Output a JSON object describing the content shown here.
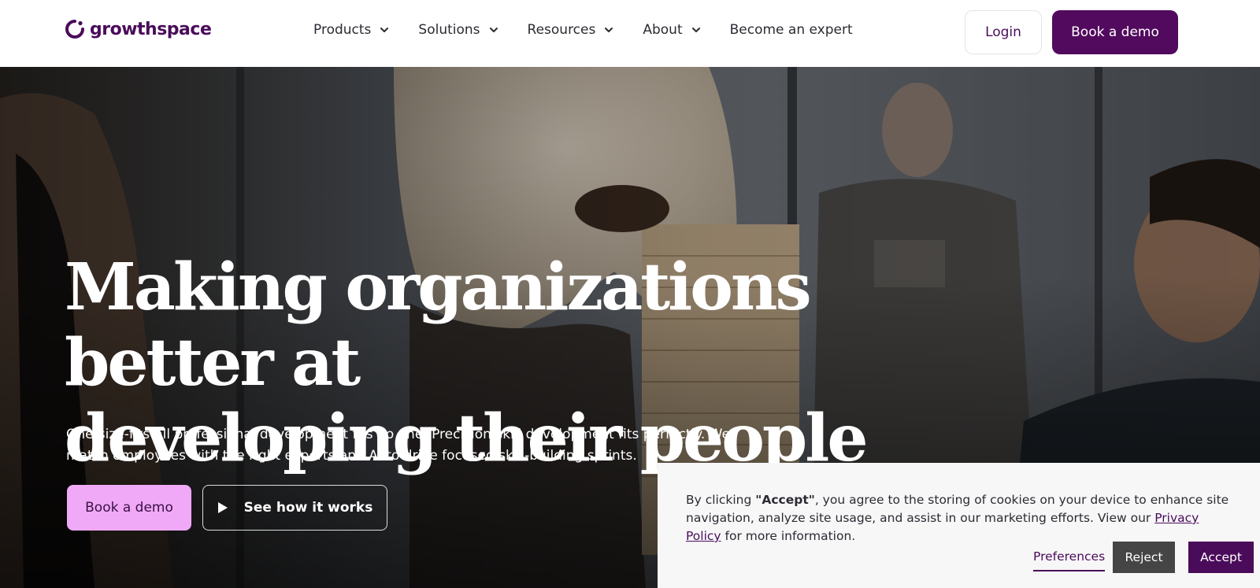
{
  "brand": {
    "name": "growthspace",
    "color": "#4a0c5a"
  },
  "nav": {
    "items": [
      {
        "label": "Products",
        "icon": "chevron-down-icon"
      },
      {
        "label": "Solutions",
        "icon": "chevron-down-icon"
      },
      {
        "label": "Resources",
        "icon": "chevron-down-icon"
      },
      {
        "label": "About",
        "icon": "chevron-down-icon"
      },
      {
        "label": "Become an expert"
      }
    ],
    "login_label": "Login",
    "demo_label": "Book a demo"
  },
  "hero": {
    "headline_line1": "Making organizations better at",
    "headline_line2": "developing their people",
    "subtext": "One-size-fits-all professional development fits no one. Precision skill development fits perfectly. We match employees with the right experts and AI to drive focused skill-building sprints.",
    "primary_button": "Book a demo",
    "secondary_button": "See how it works",
    "secondary_icon": "play-icon"
  },
  "cookie": {
    "text_prefix": "By clicking ",
    "text_bold": "\"Accept\"",
    "text_middle": ", you agree to the storing of cookies on your device to enhance site navigation, analyze site usage, and assist in our marketing efforts. View our ",
    "link_label": "Privacy Policy",
    "text_suffix": " for more information.",
    "preferences_label": "Preferences",
    "reject_label": "Reject",
    "accept_label": "Accept"
  },
  "colors": {
    "primary": "#520a5e",
    "accent_pink": "#f0a9f7",
    "reject_gray": "#454545"
  }
}
